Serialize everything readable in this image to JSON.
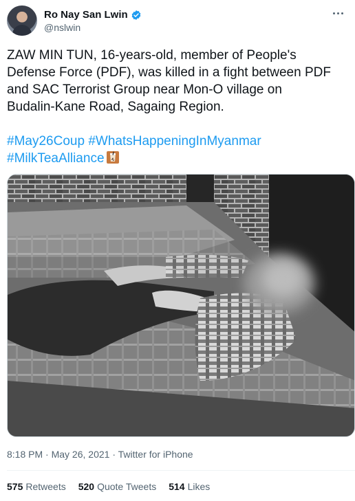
{
  "author": {
    "name": "Ro Nay San Lwin",
    "handle": "@nslwin",
    "verified": true
  },
  "tweet": {
    "text_lines": [
      "ZAW MIN TUN, 16-years-old, member of People's",
      "Defense Force (PDF), was killed in a fight between PDF",
      "and SAC Terrorist Group near Mon-O village on",
      "Budalin-Kane Road, Sagaing Region."
    ],
    "hashtags": [
      "#May26Coup",
      "#WhatsHappeningInMyanmar",
      "#MilkTeaAlliance"
    ],
    "emoji": "milk-tea-alliance-emoji"
  },
  "meta": {
    "time": "8:18 PM",
    "separator": "·",
    "date": "May 26, 2021",
    "source": "Twitter for iPhone"
  },
  "stats": {
    "retweets": {
      "count": "575",
      "label": "Retweets"
    },
    "quote_tweets": {
      "count": "520",
      "label": "Quote Tweets"
    },
    "likes": {
      "count": "514",
      "label": "Likes"
    }
  },
  "colors": {
    "link": "#1d9bf0",
    "secondary_text": "#536471",
    "verified_badge": "#1d9bf0"
  },
  "icons": {
    "more": "more-options-icon",
    "verified": "verified-badge-icon"
  }
}
